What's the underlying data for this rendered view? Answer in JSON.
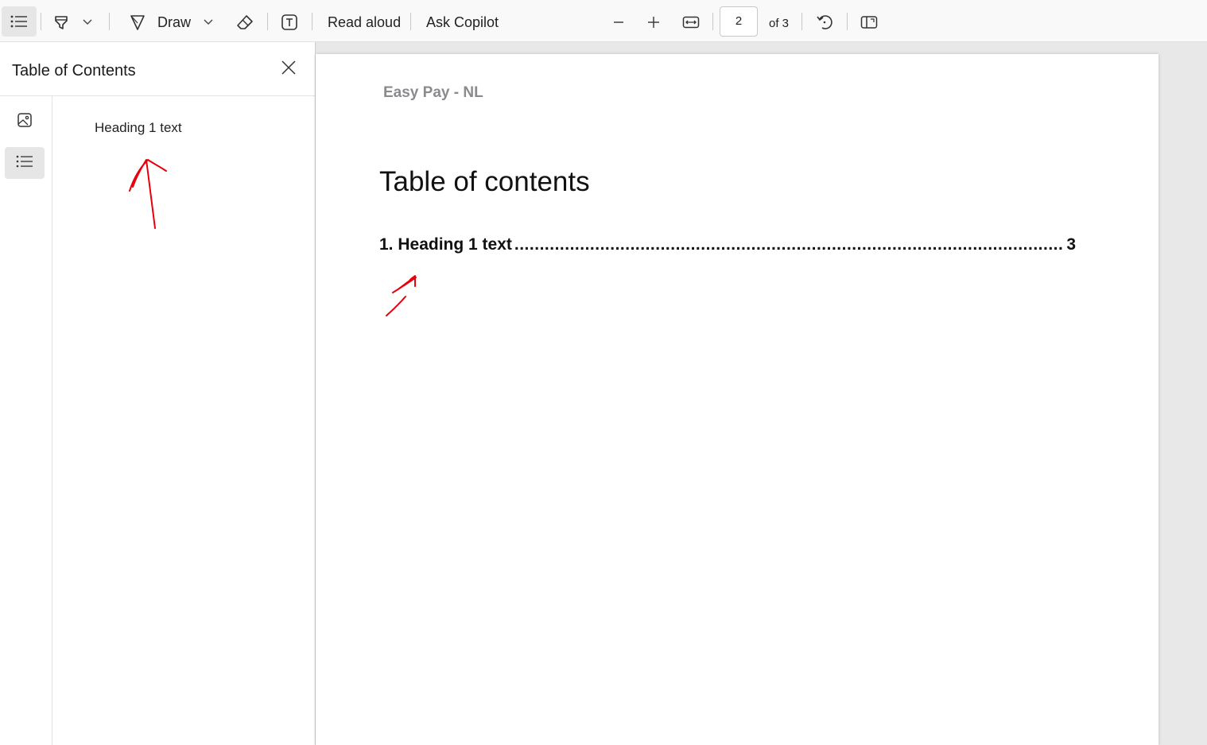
{
  "toolbar": {
    "draw_label": "Draw",
    "read_aloud_label": "Read aloud",
    "ask_copilot_label": "Ask Copilot",
    "current_page": "2",
    "page_count_label": "of 3"
  },
  "sidebar": {
    "title": "Table of Contents",
    "toc_items": [
      "Heading 1 text"
    ]
  },
  "document": {
    "header_text": "Easy Pay - NL",
    "title": "Table of contents",
    "toc_entries": [
      {
        "label": "1. Heading 1 text",
        "dots": "...........................................................................................................................",
        "page": "3"
      }
    ]
  },
  "colors": {
    "annotation_ink": "#e8000b",
    "header_gray": "#8a8a8f",
    "toolbar_bg": "#f9f9f9",
    "selected_bg": "#e6e6e6"
  },
  "icons": [
    "list-icon",
    "highlighter-icon",
    "chevron-down-icon",
    "draw-pen-icon",
    "eraser-icon",
    "text-box-icon",
    "zoom-out-icon",
    "zoom-in-icon",
    "fit-width-icon",
    "rotate-icon",
    "page-view-icon",
    "close-icon",
    "image-icon"
  ]
}
